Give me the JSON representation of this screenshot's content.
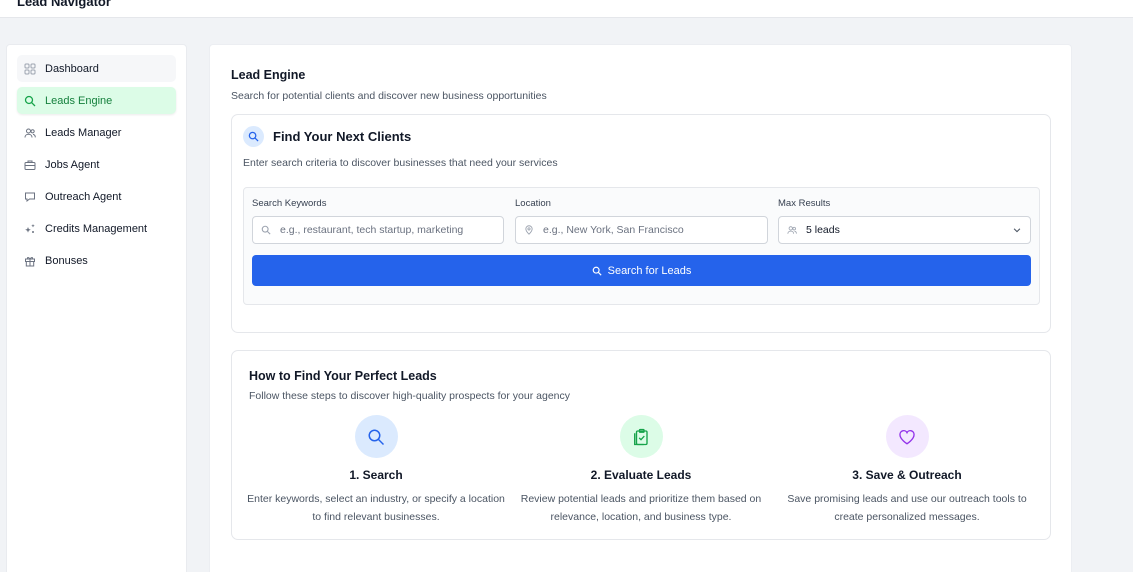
{
  "app": {
    "title": "Lead Navigator"
  },
  "sidebar": {
    "items": [
      {
        "label": "Dashboard",
        "icon": "grid-icon"
      },
      {
        "label": "Leads Engine",
        "icon": "search-icon"
      },
      {
        "label": "Leads Manager",
        "icon": "users-icon"
      },
      {
        "label": "Jobs Agent",
        "icon": "briefcase-icon"
      },
      {
        "label": "Outreach Agent",
        "icon": "message-icon"
      },
      {
        "label": "Credits Management",
        "icon": "sparkles-icon"
      },
      {
        "label": "Bonuses",
        "icon": "gift-icon"
      }
    ],
    "active_index": 1
  },
  "page": {
    "title": "Lead Engine",
    "subtitle": "Search for potential clients and discover new business opportunities"
  },
  "search_card": {
    "title": "Find Your Next Clients",
    "description": "Enter search criteria to discover businesses that need your services",
    "keywords": {
      "label": "Search Keywords",
      "placeholder": "e.g., restaurant, tech startup, marketing",
      "value": ""
    },
    "location": {
      "label": "Location",
      "placeholder": "e.g., New York, San Francisco",
      "value": ""
    },
    "max_results": {
      "label": "Max Results",
      "value": "5 leads"
    },
    "button_label": "Search for Leads"
  },
  "how_card": {
    "title": "How to Find Your Perfect Leads",
    "description": "Follow these steps to discover high-quality prospects for your agency",
    "steps": [
      {
        "title": "1. Search",
        "text": "Enter keywords, select an industry, or specify a location to find relevant businesses.",
        "icon": "search-icon",
        "color": "#2563eb",
        "bg": "#dbeafe"
      },
      {
        "title": "2. Evaluate Leads",
        "text": "Review potential leads and prioritize them based on relevance, location, and business type.",
        "icon": "clipboard-check-icon",
        "color": "#16a34a",
        "bg": "#dcfce7"
      },
      {
        "title": "3. Save & Outreach",
        "text": "Save promising leads and use our outreach tools to create personalized messages.",
        "icon": "heart-icon",
        "color": "#9333ea",
        "bg": "#f3e8ff"
      }
    ]
  },
  "colors": {
    "primary": "#2563eb",
    "active_nav_bg": "#dcfce7",
    "active_nav_text": "#15803d"
  }
}
